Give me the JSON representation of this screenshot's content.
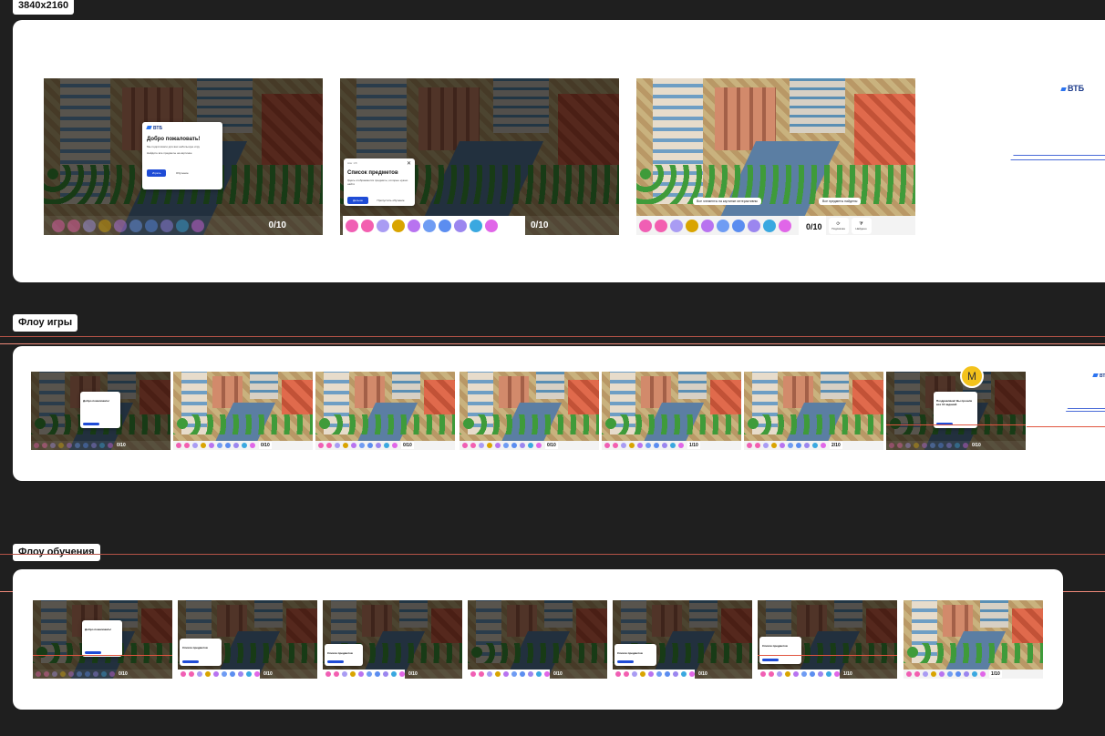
{
  "canvas": {
    "resolution_label": "3840x2160"
  },
  "section_game": {
    "label": "Флоу игры"
  },
  "section_tutorial": {
    "label": "Флоу обучения"
  },
  "brand": {
    "logo_text": "ВТБ"
  },
  "welcome_dialog": {
    "title": "Добро пожаловать!",
    "text1": "Мы подготовили для вас небольшую игру",
    "text2": "Найдите все предметы на картинке",
    "start_label": "Играть",
    "learn_label": "Обучение"
  },
  "items_dialog": {
    "eyebrow": "Шаг 1/8",
    "title": "Список предметов",
    "text": "Здесь отображаются предметы, которые нужно найти",
    "next_label": "Дальше",
    "skip_label": "Пропустить обучение"
  },
  "game": {
    "counter_initial": "0/10",
    "counter_1": "1/10",
    "counter_2": "2/10",
    "hint_label": "Подсказка",
    "found_label": "Найдено",
    "tooltip_left": "Все элементы на картинке интерактивны",
    "tooltip_right": "Все предметы найдены",
    "avatar_letter": "M",
    "finish_title": "Поздравляем! Вы прошли все 10 заданий"
  },
  "colors": {
    "accent_blue": "#1f4cd6",
    "chip_colors": [
      "#f05fb4",
      "#f35fb0",
      "#a99cf3",
      "#d9a400",
      "#b873f0",
      "#6f9cf3",
      "#5b8df0",
      "#9b86ef",
      "#3aa8e0",
      "#e066e8"
    ]
  }
}
